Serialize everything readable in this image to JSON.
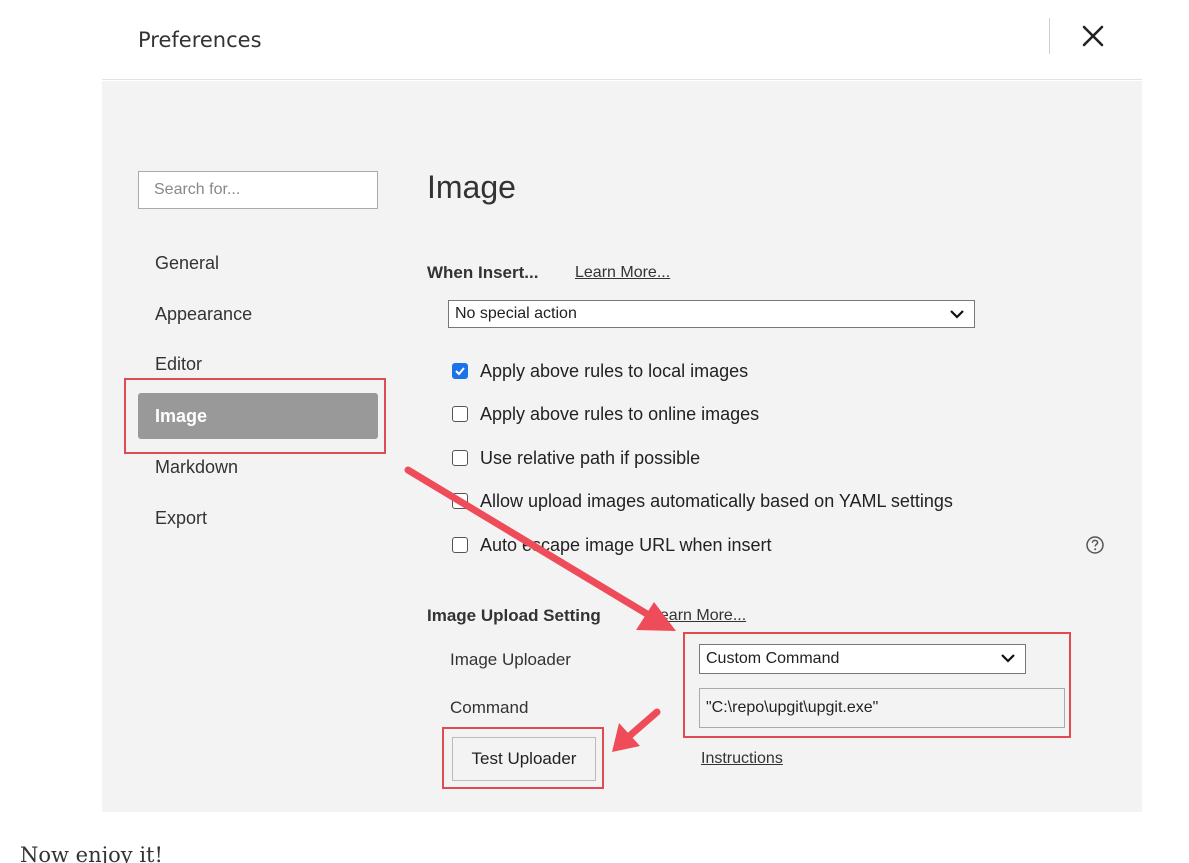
{
  "header": {
    "title": "Preferences",
    "close_icon": "close-icon"
  },
  "sidebar": {
    "search_placeholder": "Search for...",
    "items": [
      {
        "label": "General"
      },
      {
        "label": "Appearance"
      },
      {
        "label": "Editor"
      },
      {
        "label": "Image",
        "active": true
      },
      {
        "label": "Markdown"
      },
      {
        "label": "Export"
      }
    ]
  },
  "main": {
    "title": "Image",
    "when_insert": {
      "label": "When Insert...",
      "learn_more": "Learn More...",
      "action_value": "No special action"
    },
    "options": [
      {
        "label": "Apply above rules to local images",
        "checked": true
      },
      {
        "label": "Apply above rules to online images",
        "checked": false
      },
      {
        "label": "Use relative path if possible",
        "checked": false
      },
      {
        "label": "Allow upload images automatically based on YAML settings",
        "checked": false
      },
      {
        "label": "Auto escape image URL when insert",
        "checked": false
      }
    ],
    "help_icon": "question-circle-icon",
    "upload": {
      "label": "Image Upload Setting",
      "learn_more": "Learn More...",
      "uploader_label": "Image Uploader",
      "uploader_value": "Custom Command",
      "command_label": "Command",
      "command_value": "\"C:\\repo\\upgit\\upgit.exe\"",
      "test_button": "Test Uploader",
      "instructions": "Instructions"
    }
  },
  "annotations": {
    "highlight_color": "#e04a52"
  },
  "footer": {
    "text": "Now enjoy it!"
  }
}
